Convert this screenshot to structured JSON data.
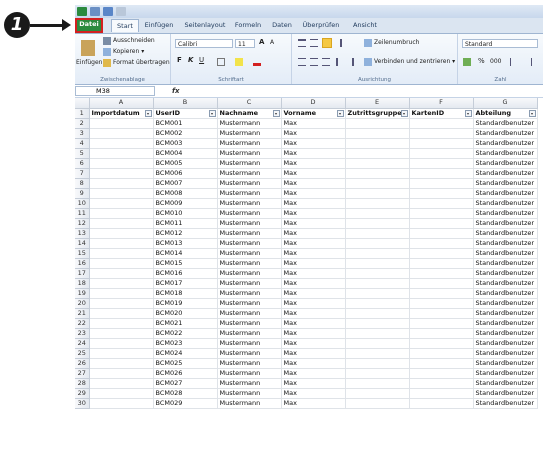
{
  "annotation": {
    "step": "1"
  },
  "tabs": [
    "Datei",
    "Start",
    "Einfügen",
    "Seitenlayout",
    "Formeln",
    "Daten",
    "Überprüfen",
    "Ansicht"
  ],
  "ribbon": {
    "clipboard": {
      "paste": "Einfügen",
      "cut": "Ausschneiden",
      "copy": "Kopieren ▾",
      "format_painter": "Format übertragen",
      "label": "Zwischenablage"
    },
    "font": {
      "name": "Calibri",
      "size": "11",
      "grow": "A",
      "shrink": "A",
      "bold": "F",
      "italic": "K",
      "underline": "U",
      "label": "Schriftart"
    },
    "alignment": {
      "wrap": "Zeilenumbruch",
      "merge": "Verbinden und zentrieren ▾",
      "label": "Ausrichtung"
    },
    "number": {
      "format": "Standard",
      "percent": "%",
      "thousands": "000",
      "label": "Zahl"
    }
  },
  "formula_bar": {
    "name_box": "M38",
    "fx": "fx",
    "value": ""
  },
  "columns": [
    "A",
    "B",
    "C",
    "D",
    "E",
    "F",
    "G"
  ],
  "headers": [
    "Importdatum",
    "UserID",
    "Nachname",
    "Vorname",
    "Zutrittsgruppe",
    "KartenID",
    "Abteilung"
  ],
  "rows": [
    [
      "",
      "BCM001",
      "Mustermann",
      "Max",
      "",
      "",
      "Standardbenutzer"
    ],
    [
      "",
      "BCM002",
      "Mustermann",
      "Max",
      "",
      "",
      "Standardbenutzer"
    ],
    [
      "",
      "BCM003",
      "Mustermann",
      "Max",
      "",
      "",
      "Standardbenutzer"
    ],
    [
      "",
      "BCM004",
      "Mustermann",
      "Max",
      "",
      "",
      "Standardbenutzer"
    ],
    [
      "",
      "BCM005",
      "Mustermann",
      "Max",
      "",
      "",
      "Standardbenutzer"
    ],
    [
      "",
      "BCM006",
      "Mustermann",
      "Max",
      "",
      "",
      "Standardbenutzer"
    ],
    [
      "",
      "BCM007",
      "Mustermann",
      "Max",
      "",
      "",
      "Standardbenutzer"
    ],
    [
      "",
      "BCM008",
      "Mustermann",
      "Max",
      "",
      "",
      "Standardbenutzer"
    ],
    [
      "",
      "BCM009",
      "Mustermann",
      "Max",
      "",
      "",
      "Standardbenutzer"
    ],
    [
      "",
      "BCM010",
      "Mustermann",
      "Max",
      "",
      "",
      "Standardbenutzer"
    ],
    [
      "",
      "BCM011",
      "Mustermann",
      "Max",
      "",
      "",
      "Standardbenutzer"
    ],
    [
      "",
      "BCM012",
      "Mustermann",
      "Max",
      "",
      "",
      "Standardbenutzer"
    ],
    [
      "",
      "BCM013",
      "Mustermann",
      "Max",
      "",
      "",
      "Standardbenutzer"
    ],
    [
      "",
      "BCM014",
      "Mustermann",
      "Max",
      "",
      "",
      "Standardbenutzer"
    ],
    [
      "",
      "BCM015",
      "Mustermann",
      "Max",
      "",
      "",
      "Standardbenutzer"
    ],
    [
      "",
      "BCM016",
      "Mustermann",
      "Max",
      "",
      "",
      "Standardbenutzer"
    ],
    [
      "",
      "BCM017",
      "Mustermann",
      "Max",
      "",
      "",
      "Standardbenutzer"
    ],
    [
      "",
      "BCM018",
      "Mustermann",
      "Max",
      "",
      "",
      "Standardbenutzer"
    ],
    [
      "",
      "BCM019",
      "Mustermann",
      "Max",
      "",
      "",
      "Standardbenutzer"
    ],
    [
      "",
      "BCM020",
      "Mustermann",
      "Max",
      "",
      "",
      "Standardbenutzer"
    ],
    [
      "",
      "BCM021",
      "Mustermann",
      "Max",
      "",
      "",
      "Standardbenutzer"
    ],
    [
      "",
      "BCM022",
      "Mustermann",
      "Max",
      "",
      "",
      "Standardbenutzer"
    ],
    [
      "",
      "BCM023",
      "Mustermann",
      "Max",
      "",
      "",
      "Standardbenutzer"
    ],
    [
      "",
      "BCM024",
      "Mustermann",
      "Max",
      "",
      "",
      "Standardbenutzer"
    ],
    [
      "",
      "BCM025",
      "Mustermann",
      "Max",
      "",
      "",
      "Standardbenutzer"
    ],
    [
      "",
      "BCM026",
      "Mustermann",
      "Max",
      "",
      "",
      "Standardbenutzer"
    ],
    [
      "",
      "BCM027",
      "Mustermann",
      "Max",
      "",
      "",
      "Standardbenutzer"
    ],
    [
      "",
      "BCM028",
      "Mustermann",
      "Max",
      "",
      "",
      "Standardbenutzer"
    ],
    [
      "",
      "BCM029",
      "Mustermann",
      "Max",
      "",
      "",
      "Standardbenutzer"
    ]
  ],
  "colors": {
    "file_tab": "#2b8a3e",
    "highlight": "#d32020",
    "accent": "#1e395b"
  }
}
